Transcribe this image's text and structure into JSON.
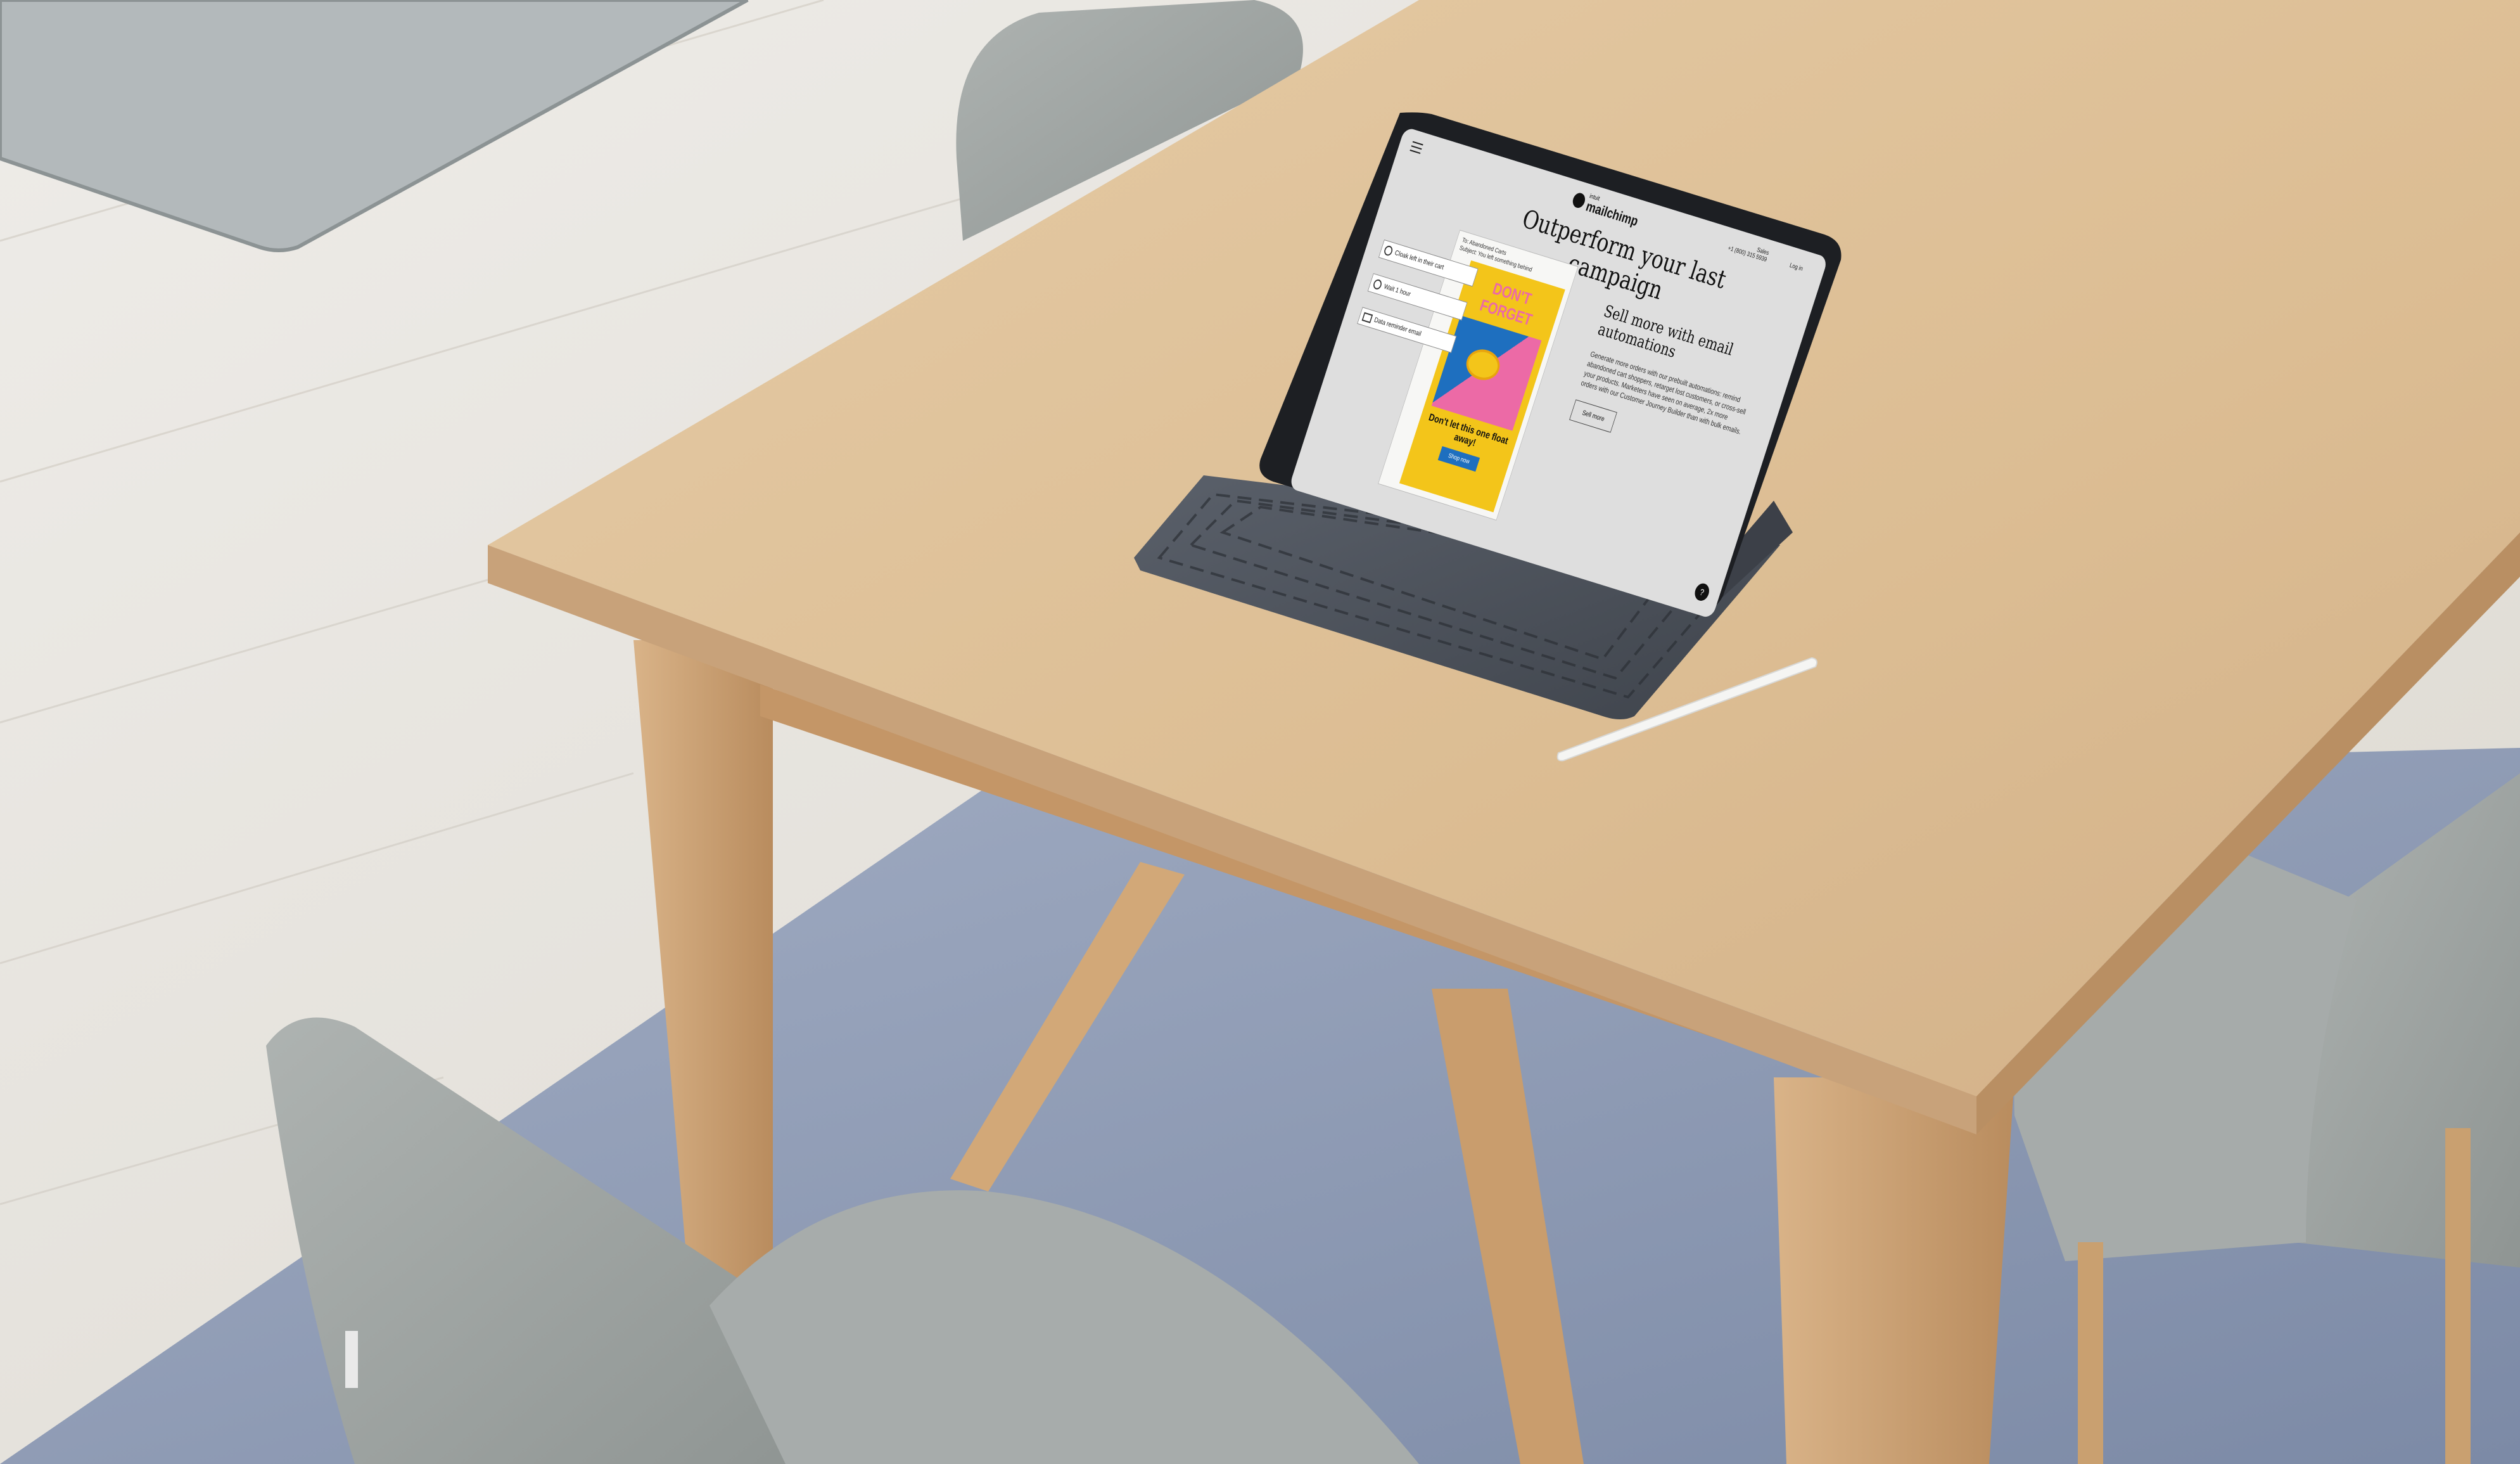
{
  "screen": {
    "brand_prefix": "intuit",
    "brand": "mailchimp",
    "nav_sales": "Sales",
    "nav_phone": "+1 (800) 315 5939",
    "nav_login": "Log in",
    "headline": "Outperform your last campaign",
    "email_to": "To: Abandoned Carts",
    "email_subject": "Subject: You left something behind",
    "flow_step_1": "Cloak left in their cart",
    "flow_step_2": "Wait 1 hour",
    "flow_step_3": "Data reminder email",
    "promo_title_1": "DON'T",
    "promo_title_2": "FORGET",
    "promo_tagline": "Don't let this one float away!",
    "promo_button": "Shop now",
    "section_title": "Sell more with email automations",
    "section_body": "Generate more orders with our prebuilt automations: remind abandoned cart shoppers, retarget lost customers, or cross-sell your products. Marketers have seen on average, 2x more orders with our Customer Journey Builder than with bulk emails.",
    "section_button": "Sell more",
    "help_badge": "?"
  },
  "colors": {
    "floor": "#e6e3dd",
    "rug": "#8e9cb6",
    "table_top": "#dcbf98",
    "table_edge": "#caa57a",
    "chair": "#9ea4a2",
    "screen_bg": "#dedede",
    "promo_yellow": "#f3c51a",
    "promo_pink": "#ec6aa6",
    "promo_blue": "#1e6fbf",
    "keyboard": "#4a4f58"
  }
}
